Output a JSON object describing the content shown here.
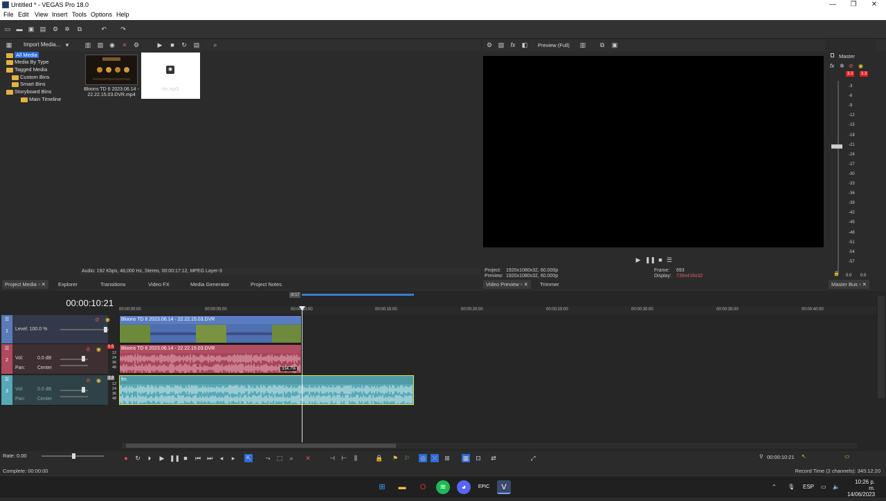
{
  "window": {
    "title": "Untitled * - VEGAS Pro 18.0",
    "minimize": "—",
    "maximize": "❐",
    "close": "✕"
  },
  "menu": [
    "File",
    "Edit",
    "View",
    "Insert",
    "Tools",
    "Options",
    "Help"
  ],
  "project_media": {
    "import_label": "Import Media...",
    "tree": [
      {
        "label": "All Media",
        "selected": true
      },
      {
        "label": "Media By Type"
      },
      {
        "label": "Tagged Media"
      },
      {
        "label": "Custom Bins"
      },
      {
        "label": "Smart Bins"
      },
      {
        "label": "Storyboard Bins"
      },
      {
        "label": "Main Timeline"
      }
    ],
    "items": [
      {
        "label": "Bloons TD 6 2023.06.14 - 22.22.15.03.DVR.mp4"
      },
      {
        "label": "fm.mp3"
      }
    ],
    "status": "Audio: 192 Kbps, 48,000 Hz, Stereo, 00:00:17:12, MPEG Layer-3"
  },
  "dock_tabs_left": [
    "Project Media",
    "Explorer",
    "Transitions",
    "Video FX",
    "Media Generator",
    "Project Notes"
  ],
  "preview": {
    "mode": "Preview (Full)",
    "project_label": "Project:",
    "project_value": "1920x1080x32, 60.000p",
    "preview_label": "Preview:",
    "preview_value": "1920x1080x32, 60.000p",
    "frame_label": "Frame:",
    "frame_value": "693",
    "display_label": "Display:",
    "display_value": "739x416x32",
    "tabs": [
      "Video Preview",
      "Trimmer"
    ]
  },
  "master": {
    "title": "Master",
    "peak_left": "3.3",
    "peak_right": "3.3",
    "scale": [
      "3",
      "6",
      "9",
      "12",
      "15",
      "18",
      "21",
      "24",
      "27",
      "30",
      "33",
      "36",
      "39",
      "42",
      "45",
      "48",
      "51",
      "54",
      "57"
    ],
    "bottom_left": "0.0",
    "bottom_right": "0.0",
    "tab": "Master Bus"
  },
  "timeline": {
    "current_time": "00:00:10:21",
    "region_label": "-6:17",
    "ruler": [
      "00:00:00:00",
      "00:00:05:00",
      "00:00:10:00",
      "00:00:15:00",
      "00:00:20:00",
      "00:00:25:00",
      "00:00:30:00",
      "00:00:35:00",
      "00:00:40:00"
    ],
    "tracks": [
      {
        "num": "1",
        "label1": "Level: 100.0 %",
        "clip": "Bloons TD 6 2023.06.14 - 22.22.15.03.DVR"
      },
      {
        "num": "2",
        "vol_label": "Vol:",
        "vol": "0.0 dB",
        "pan_label": "Pan:",
        "pan": "Center",
        "clip": "Bloons TD 6 2023.06.14 - 22.22.15.03.DVR",
        "gain": "334.7%",
        "db_top": "0.5"
      },
      {
        "num": "3",
        "vol_label": "Vol:",
        "vol": "0.0 dB",
        "pan_label": "Pan:",
        "pan": "Center",
        "clip": "fm",
        "db_top": "3.3"
      }
    ],
    "db_marks": [
      "12",
      "24",
      "36",
      "48"
    ]
  },
  "transport": {
    "rate": "Rate: 0.00",
    "time": "00:00:10:21"
  },
  "status": {
    "left": "Complete: 00:00:00",
    "right": "Record Time (2 channels): 345:12:20"
  },
  "taskbar": {
    "lang": "ESP",
    "time": "10:26 p. m.",
    "date": "14/06/2023"
  },
  "colors": {
    "video_track": "#5a7bb8",
    "audio_track": "#b04a5e",
    "music_track": "#57a8b8",
    "selection": "#2d6bd6"
  }
}
